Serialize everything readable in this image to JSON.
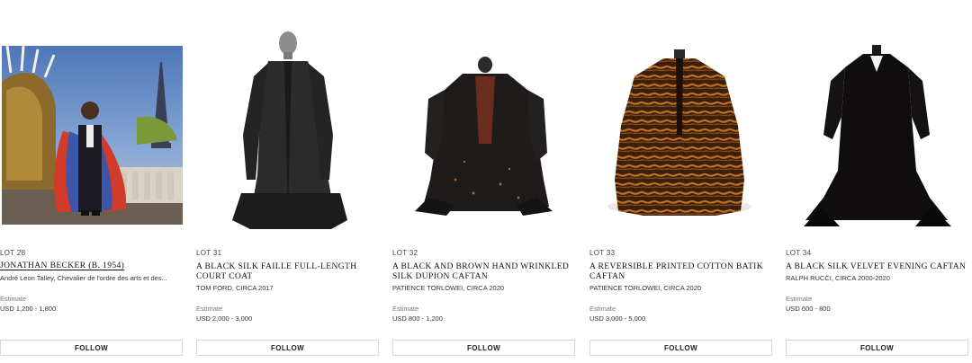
{
  "lots": [
    {
      "lot_label": "LOT 28",
      "title": "JONATHAN BECKER (B. 1954)",
      "subtitle": "André Leon Talley, Chevalier de l'ordre des arts et des...",
      "estimate_label": "Estimate",
      "estimate_value": "USD 1,200 - 1,800",
      "follow_label": "FOLLOW",
      "image": "photograph-eiffel-tower"
    },
    {
      "lot_label": "LOT 31",
      "title": "A BLACK SILK FAILLE FULL-LENGTH COURT COAT",
      "subtitle": "TOM FORD, CIRCA 2017",
      "estimate_label": "Estimate",
      "estimate_value": "USD 2,000 - 3,000",
      "follow_label": "FOLLOW",
      "image": "black-court-coat"
    },
    {
      "lot_label": "LOT 32",
      "title": "A BLACK AND BROWN HAND WRINKLED SILK DUPION CAFTAN",
      "subtitle": "PATIENCE TORLOWEI, CIRCA 2020",
      "estimate_label": "Estimate",
      "estimate_value": "USD 800 - 1,200",
      "follow_label": "FOLLOW",
      "image": "black-brown-caftan"
    },
    {
      "lot_label": "LOT 33",
      "title": "A REVERSIBLE PRINTED COTTON BATIK CAFTAN",
      "subtitle": "PATIENCE TORLOWEI, CIRCA 2020",
      "estimate_label": "Estimate",
      "estimate_value": "USD 3,000 - 5,000",
      "follow_label": "FOLLOW",
      "image": "batik-caftan"
    },
    {
      "lot_label": "LOT 34",
      "title": "A BLACK SILK VELVET EVENING CAFTAN",
      "subtitle": "RALPH RUCCI, CIRCA 2000-2020",
      "estimate_label": "Estimate",
      "estimate_value": "USD 600 - 800",
      "follow_label": "FOLLOW",
      "image": "black-velvet-caftan"
    }
  ]
}
